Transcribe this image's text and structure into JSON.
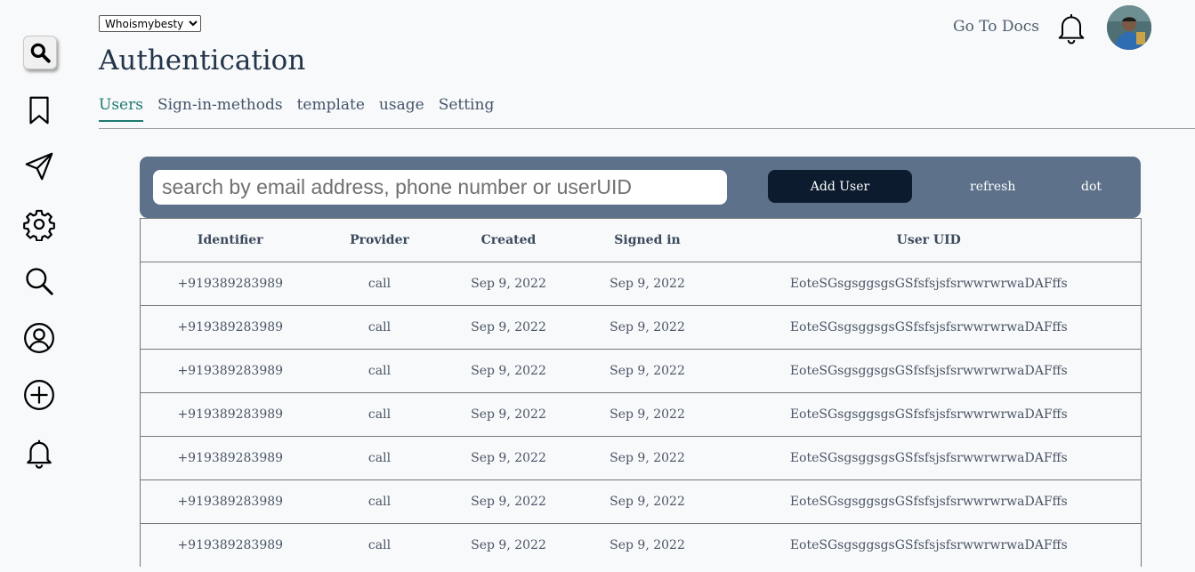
{
  "sidebar": {
    "icons": [
      "search-box-icon",
      "bookmark-icon",
      "send-icon",
      "gear-icon",
      "search-icon",
      "user-icon",
      "plus-circle-icon",
      "bell-icon"
    ]
  },
  "header": {
    "project": {
      "selected": "Whoismybesty"
    },
    "title": "Authentication",
    "docs_link": "Go To Docs",
    "bell_icon": "bell-icon",
    "avatar_icon": "avatar"
  },
  "tabs": [
    {
      "label": "Users",
      "active": true
    },
    {
      "label": "Sign-in-methods",
      "active": false
    },
    {
      "label": "template",
      "active": false
    },
    {
      "label": "usage",
      "active": false
    },
    {
      "label": "Setting",
      "active": false
    }
  ],
  "toolbar": {
    "search_placeholder": "search by email address, phone number or userUID",
    "add_user_label": "Add User",
    "refresh_label": "refresh",
    "dot_label": "dot"
  },
  "table": {
    "columns": [
      "Identifier",
      "Provider",
      "Created",
      "Signed in",
      "User UID"
    ],
    "rows": [
      [
        "+919389283989",
        "call",
        "Sep 9, 2022",
        "Sep 9, 2022",
        "EoteSGsgsggsgsGSfsfsjsfsrwwrwrwaDAFffs"
      ],
      [
        "+919389283989",
        "call",
        "Sep 9, 2022",
        "Sep 9, 2022",
        "EoteSGsgsggsgsGSfsfsjsfsrwwrwrwaDAFffs"
      ],
      [
        "+919389283989",
        "call",
        "Sep 9, 2022",
        "Sep 9, 2022",
        "EoteSGsgsggsgsGSfsfsjsfsrwwrwrwaDAFffs"
      ],
      [
        "+919389283989",
        "call",
        "Sep 9, 2022",
        "Sep 9, 2022",
        "EoteSGsgsggsgsGSfsfsjsfsrwwrwrwaDAFffs"
      ],
      [
        "+919389283989",
        "call",
        "Sep 9, 2022",
        "Sep 9, 2022",
        "EoteSGsgsggsgsGSfsfsjsfsrwwrwrwaDAFffs"
      ],
      [
        "+919389283989",
        "call",
        "Sep 9, 2022",
        "Sep 9, 2022",
        "EoteSGsgsggsgsGSfsfsjsfsrwwrwrwaDAFffs"
      ],
      [
        "+919389283989",
        "call",
        "Sep 9, 2022",
        "Sep 9, 2022",
        "EoteSGsgsggsgsGSfsfsjsfsrwwrwrwaDAFffs"
      ]
    ]
  },
  "colors": {
    "toolbar_bg": "#5d718a",
    "add_user_bg": "#0c1b2e",
    "active_tab": "#1f7a72",
    "title": "#23354a"
  }
}
